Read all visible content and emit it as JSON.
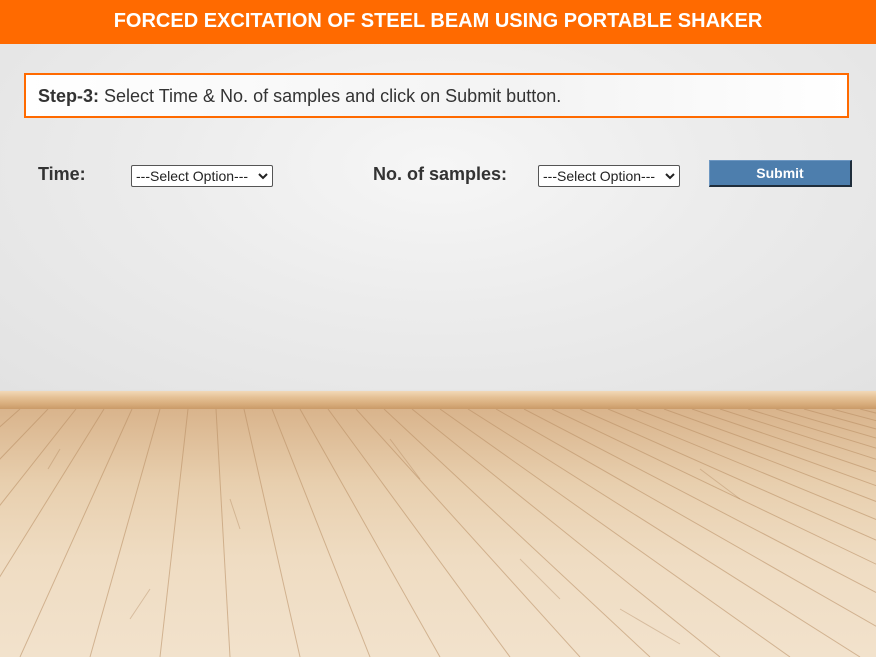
{
  "header": {
    "title": "FORCED EXCITATION OF STEEL BEAM USING PORTABLE SHAKER"
  },
  "instruction": {
    "step_label": "Step-3:",
    "text": " Select Time & No. of samples and click on Submit button."
  },
  "form": {
    "time_label": "Time:",
    "time_select_value": "---Select Option---",
    "samples_label": "No. of samples:",
    "samples_select_value": "---Select Option---",
    "submit_label": "Submit"
  },
  "colors": {
    "accent": "#ff6a00",
    "button": "#4d7ead",
    "text": "#333333"
  },
  "icons": {
    "select_arrow": "chevron-down-icon"
  }
}
